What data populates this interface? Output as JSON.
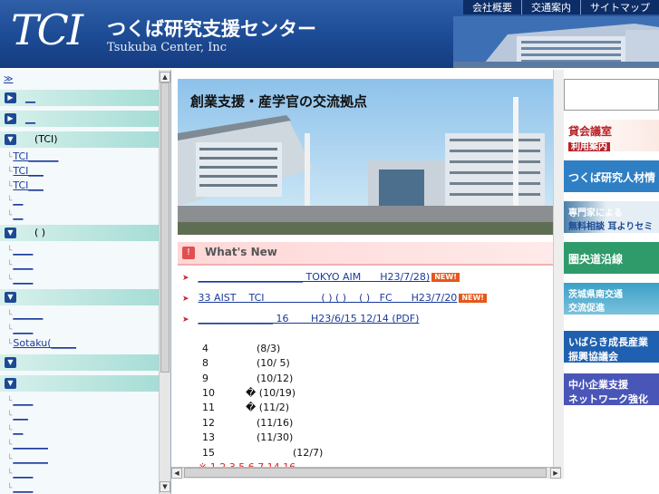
{
  "header": {
    "logo": "TCI",
    "tagline": "つくば研究支援センター",
    "subtitle": "Tsukuba Center, Inc",
    "links": [
      "会社概要",
      "交通案内",
      "サイトマップ"
    ]
  },
  "sidebar": {
    "top_link": "≫",
    "groups": [
      {
        "label": "__",
        "type": "closed"
      },
      {
        "label": "__",
        "type": "closed"
      },
      {
        "label": "(TCI)",
        "type": "open",
        "items": [
          "TCI______",
          "TCI___",
          "TCI___",
          "__",
          "__"
        ]
      },
      {
        "label": "(  )",
        "type": "open",
        "items": [
          "____",
          "____",
          "____"
        ]
      },
      {
        "label": "",
        "type": "open",
        "items": [
          "______",
          "____",
          "Sotaku(_____"
        ]
      },
      {
        "label": "",
        "type": "closed"
      },
      {
        "label": "",
        "type": "open",
        "items": [
          "____",
          "___",
          "__",
          "_______",
          "_______",
          "____",
          "____"
        ]
      }
    ]
  },
  "banner": {
    "title": "創業支援・産学官の交流拠点"
  },
  "whats_new": {
    "title": "What's New",
    "items": [
      {
        "text": "_____________________ TOKYO AIM      H23/7/28)",
        "new": "NEW!"
      },
      {
        "text": "33 AIST    TCI                  ( ) ( )    ( )   FC      H23/7/20",
        "new": "NEW!"
      },
      {
        "text": "_______________ 16       H23/6/15 12/14 (PDF)",
        "new": ""
      }
    ]
  },
  "events": [
    {
      "num": "4",
      "date": "(8/3)"
    },
    {
      "num": "8",
      "date": "(10/ 5)"
    },
    {
      "num": "9",
      "date": "(10/12)"
    },
    {
      "num": "10",
      "date": "� (10/19)"
    },
    {
      "num": "11",
      "date": "� (11/2)"
    },
    {
      "num": "12",
      "date": "(11/16)"
    },
    {
      "num": "13",
      "date": "(11/30)"
    },
    {
      "num": "15",
      "date": "(12/7)"
    }
  ],
  "events_note": "※ 1 2 3 5 6 7 14 16",
  "right_banners": [
    {
      "label": "貸会議室",
      "sub": "利用案内",
      "color": "#b8232a"
    },
    {
      "label": "つくば研究人材情",
      "sub": "",
      "color": "#2f7fc4"
    },
    {
      "label": "専門家による",
      "sub": "無料相談 耳よりセミ",
      "color": "#4a7fa8"
    },
    {
      "label": "圏央道沿線",
      "sub": "",
      "color": "#2f9a6a"
    },
    {
      "label": "茨城県南交通",
      "sub": "交流促進",
      "color": "#3aa0c8"
    },
    {
      "label": "いばらき成長産業",
      "sub": "振興協議会",
      "color": "#2060b0"
    },
    {
      "label": "中小企業支援",
      "sub": "ネットワーク強化",
      "color": "#4a55b8"
    }
  ]
}
